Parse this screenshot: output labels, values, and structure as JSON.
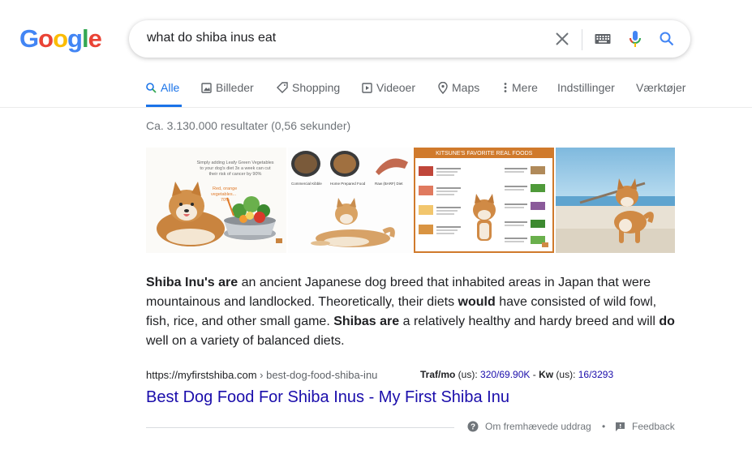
{
  "logo": {
    "letters": [
      "G",
      "o",
      "o",
      "g",
      "l",
      "e"
    ],
    "colors": [
      "#4285F4",
      "#EA4335",
      "#FBBC05",
      "#4285F4",
      "#34A853",
      "#EA4335"
    ]
  },
  "search": {
    "query": "what do shiba inus eat",
    "icons": [
      "close-icon",
      "keyboard-icon",
      "mic-icon",
      "search-icon"
    ]
  },
  "tabs": [
    {
      "label": "Alle",
      "icon": "search-icon",
      "active": true
    },
    {
      "label": "Billeder",
      "icon": "image-icon"
    },
    {
      "label": "Shopping",
      "icon": "tag-icon"
    },
    {
      "label": "Videoer",
      "icon": "play-icon"
    },
    {
      "label": "Maps",
      "icon": "pin-icon"
    },
    {
      "label": "Mere",
      "icon": "more-vert-icon"
    },
    {
      "label": "Indstillinger"
    },
    {
      "label": "Værktøjer"
    }
  ],
  "result_stats": "Ca. 3.130.000 resultater (0,56 sekunder)",
  "images": {
    "img1_caption": "Simply adding Leafy Green Vegetables to your dog's diet 3x a week can cut their risk of cancer by 90%",
    "img1_caption2": "Red, orange vegetables... 70%",
    "img2_labels": [
      "Commercial Kibble",
      "Home Prepared Food",
      "Raw (BARF) Diet"
    ],
    "img3_title": "KITSUNE'S FAVORITE REAL FOODS"
  },
  "snippet": {
    "b1": "Shiba Inu's are",
    "t1": " an ancient Japanese dog breed that inhabited areas in Japan that were mountainous and landlocked. Theoretically, their diets ",
    "b2": "would",
    "t2": " have consisted of wild fowl, fish, rice, and other small game. ",
    "b3": "Shibas are",
    "t3": " a relatively healthy and hardy breed and will ",
    "b4": "do",
    "t4": " well on a variety of balanced diets."
  },
  "result": {
    "url": "https://myfirstshiba.com",
    "breadcrumb": " › best-dog-food-shiba-inu",
    "seo_traf_label": "Traf/mo",
    "seo_us1": " (us): ",
    "seo_traf_value": "320/69.90K",
    "seo_sep": " - ",
    "seo_kw_label": "Kw",
    "seo_us2": " (us): ",
    "seo_kw_value": "16/3293",
    "title": "Best Dog Food For Shiba Inus - My First Shiba Inu"
  },
  "footer": {
    "about": "Om fremhævede uddrag",
    "dot": "•",
    "feedback": "Feedback"
  }
}
